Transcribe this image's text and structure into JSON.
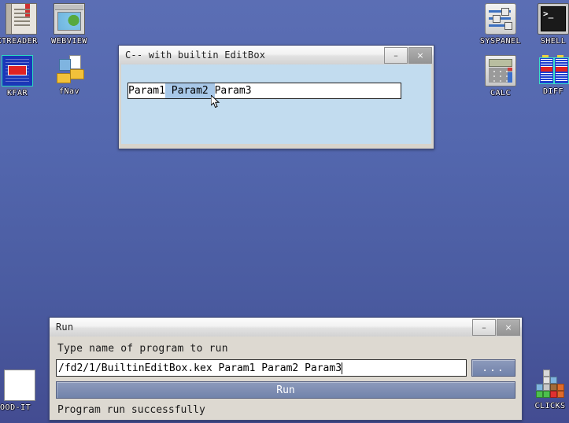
{
  "desktop": {
    "background_top": "#5b6eb4",
    "background_bottom": "#434c91",
    "icons": [
      {
        "name": "txtreader",
        "label": "TXTREADER",
        "icon": "book-icon"
      },
      {
        "name": "webview",
        "label": "WEBVIEW",
        "icon": "webview-window-icon"
      },
      {
        "name": "kfar",
        "label": "KFAR",
        "icon": "kfar-icon"
      },
      {
        "name": "fnav",
        "label": "fNav",
        "icon": "folders-icon"
      },
      {
        "name": "syspanel",
        "label": "SYSPANEL",
        "icon": "sliders-icon"
      },
      {
        "name": "shell",
        "label": "SHELL",
        "icon": "terminal-icon"
      },
      {
        "name": "calc",
        "label": "CALC",
        "icon": "calculator-icon"
      },
      {
        "name": "diff",
        "label": "DIFF",
        "icon": "diff-tables-icon"
      },
      {
        "name": "flood-it",
        "label": "FLOOD-IT",
        "icon": "color-grid-icon"
      },
      {
        "name": "clicks",
        "label": "CLICKS",
        "icon": "tetris-blocks-icon"
      }
    ]
  },
  "editbox_window": {
    "title": "C-- with builtin EditBox",
    "minimize_label": "–",
    "close_label": "×",
    "field": {
      "before_selection": "Param1",
      "selection": " Param2 ",
      "after_selection": "Param3",
      "full_value": "Param1 Param2 Param3"
    },
    "body_color": "#c2dcef"
  },
  "run_window": {
    "title": "Run",
    "minimize_label": "–",
    "close_label": "×",
    "prompt": "Type name of program to run",
    "command_value": "/fd2/1/BuiltinEditBox.kex Param1 Param2 Param3",
    "browse_label": "...",
    "run_label": "Run",
    "status": "Program run successfully"
  }
}
